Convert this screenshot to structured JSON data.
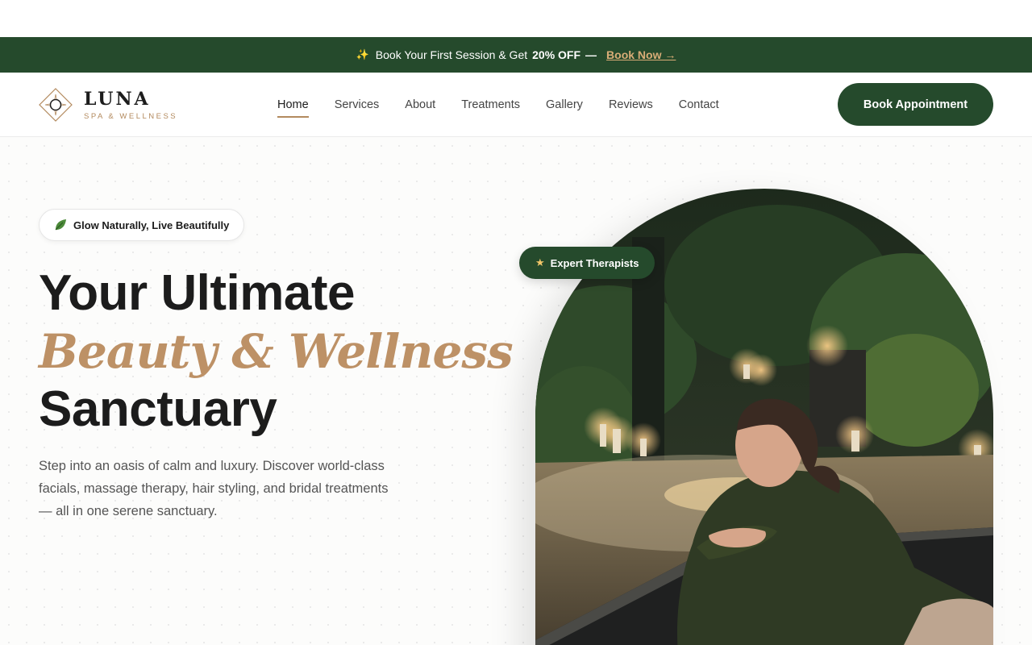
{
  "promo": {
    "icon": "sparkle-icon",
    "text": "Book Your First Session & Get",
    "highlight": "20% OFF",
    "dash": "—",
    "link": "Book Now →"
  },
  "header": {
    "brand": "LUNA",
    "tagline": "SPA & WELLNESS",
    "nav": [
      {
        "label": "Home",
        "active": true
      },
      {
        "label": "Services"
      },
      {
        "label": "About"
      },
      {
        "label": "Treatments"
      },
      {
        "label": "Gallery"
      },
      {
        "label": "Reviews"
      },
      {
        "label": "Contact"
      }
    ],
    "cta": "Book Appointment"
  },
  "hero": {
    "badge": "Glow Naturally, Live Beautifully",
    "badge_icon": "leaf-icon",
    "title_line1": "Your Ultimate",
    "title_line2": "Beauty & Wellness",
    "title_line3": "Sanctuary",
    "description": "Step into an oasis of calm and luxury. Discover world-class facials, massage therapy, hair styling, and bridal treatments — all in one serene sanctuary.",
    "expert_badge": "Expert Therapists",
    "expert_icon": "star-icon"
  },
  "colors": {
    "brand_green": "#254a2c",
    "accent_gold": "#bd9166"
  }
}
